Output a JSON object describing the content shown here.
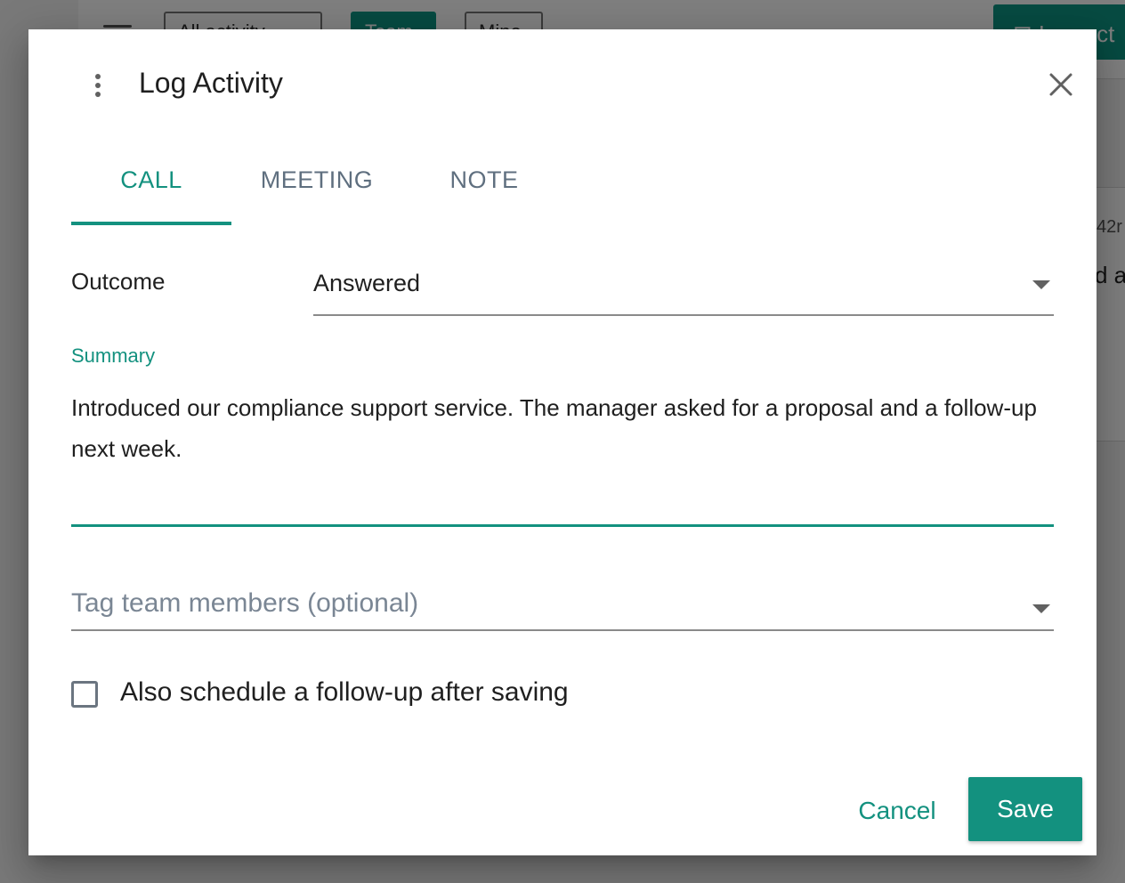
{
  "background": {
    "filters": [
      "All activity",
      "Team",
      "Mine"
    ],
    "log_button_label": "Log act",
    "card_meta": "42r",
    "card_text": "d a"
  },
  "dialog": {
    "title": "Log Activity",
    "menu_icon": "more-vert-icon",
    "close_icon": "close-icon",
    "tabs": [
      {
        "label": "CALL",
        "active": true
      },
      {
        "label": "MEETING",
        "active": false
      },
      {
        "label": "NOTE",
        "active": false
      }
    ],
    "outcome": {
      "label": "Outcome",
      "value": "Answered"
    },
    "summary": {
      "label": "Summary",
      "value": "Introduced our compliance support service. The manager asked for a proposal and a follow-up next week."
    },
    "tag_members": {
      "placeholder": "Tag team members (optional)"
    },
    "follow_up": {
      "label": "Also schedule a follow-up after saving",
      "checked": false
    },
    "actions": {
      "cancel_label": "Cancel",
      "save_label": "Save"
    }
  },
  "colors": {
    "accent": "#13917f",
    "overlay": "rgba(0,0,0,0.5)"
  }
}
